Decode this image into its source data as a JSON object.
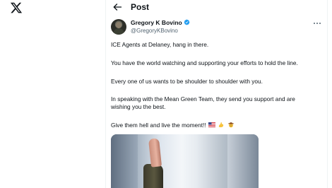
{
  "header": {
    "title": "Post"
  },
  "post": {
    "author_name": "Gregory K Bovino",
    "author_handle": "@GregoryKBovino",
    "paragraphs": [
      "ICE Agents at Delaney, hang in there.",
      "You have the world watching and supporting your efforts to hold the line.",
      "Every one of us wants to be shoulder to shoulder with you.",
      "In speaking with the Mean Green Team, they send you support and are",
      "wishing you the best.",
      "Give them hell and live the moment!!"
    ],
    "emojis": [
      "us-flag-emoji",
      "flexed-biceps-emoji",
      "cowboy-hat-face-emoji"
    ]
  },
  "colors": {
    "text": "#0f1419",
    "secondary_text": "#536471",
    "verified_blue": "#1d9bf0",
    "border": "#eff3f4"
  }
}
